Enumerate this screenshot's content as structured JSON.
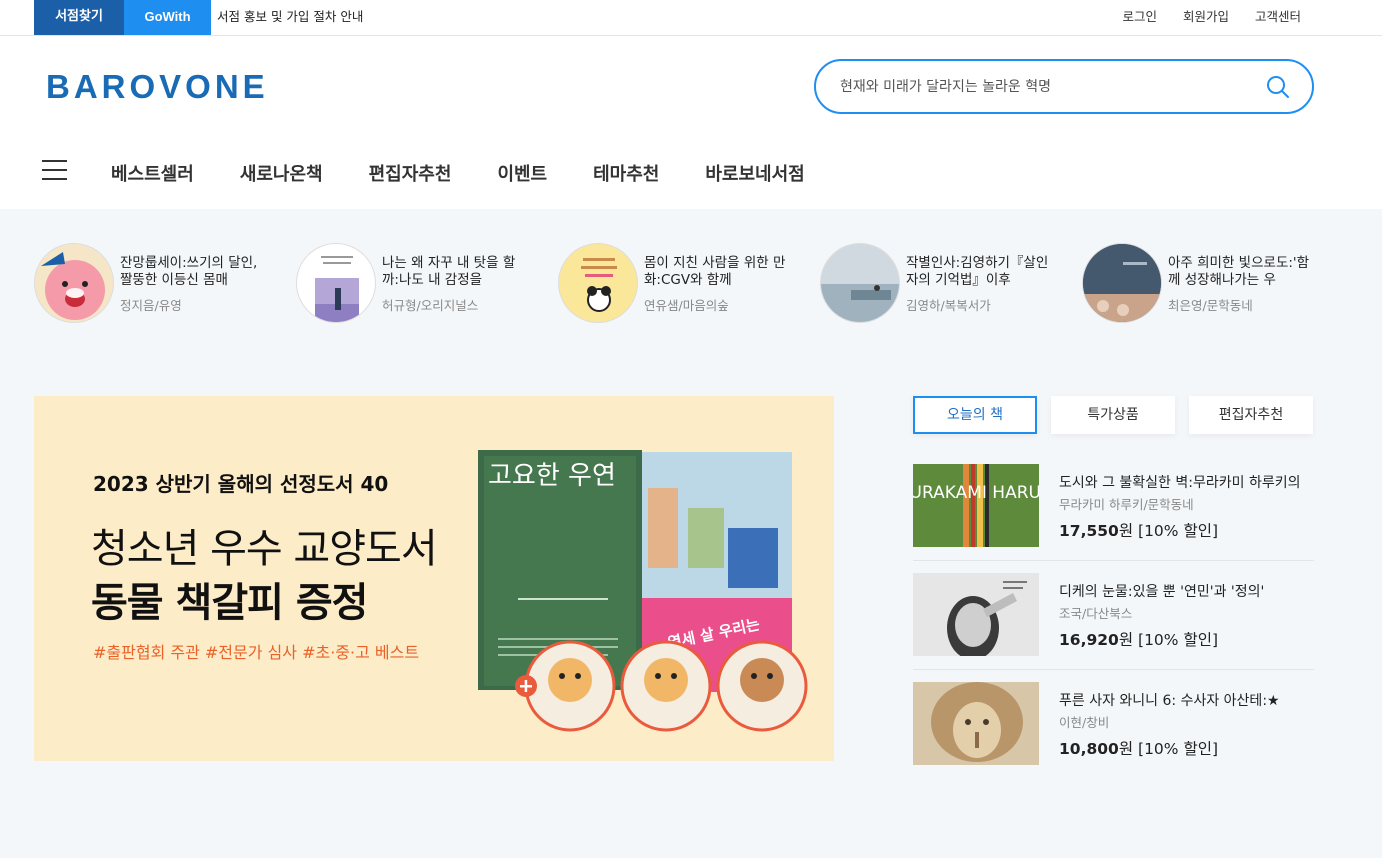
{
  "topbar": {
    "store_find": "서점찾기",
    "gowith": "GoWith",
    "notice": "서점 홍보 및 가입 절차 안내",
    "links": [
      "로그인",
      "회원가입",
      "고객센터"
    ]
  },
  "header": {
    "logo_text": "BAROVONE",
    "search_placeholder": "현재와 미래가 달라지는 놀라운 혁명"
  },
  "nav": [
    "베스트셀러",
    "새로나온책",
    "편집자추천",
    "이벤트",
    "테마추천",
    "바로보네서점"
  ],
  "stories": [
    {
      "title": "잔망룹세이:쓰기의 달인, 짤뚱한 이등신 몸매",
      "author": "정지음/유영"
    },
    {
      "title": "나는 왜 자꾸 내 탓을 할까:나도 내 감정을",
      "author": "허규형/오리지널스"
    },
    {
      "title": "몸이 지친 사람을 위한 만화:CGV와 함께",
      "author": "연유샘/마음의숲"
    },
    {
      "title": "작별인사:김영하기『살인자의 기억법』이후",
      "author": "김영하/복복서가"
    },
    {
      "title": "아주 희미한 빛으로도:'함께 성장해나가는 우",
      "author": "최은영/문학동네"
    }
  ],
  "banner": {
    "subtitle": "2023 상반기 올해의 선정도서 40",
    "line1": "청소년 우수 교양도서",
    "line2": "동물 책갈피 증정",
    "tags": "#출판협회 주관 #전문가 심사 #초·중·고 베스트",
    "book1_title": "고요한 우연",
    "book2_badge": "열세 살 우리는"
  },
  "tabs": [
    "오늘의 책",
    "특가상품",
    "편집자추천"
  ],
  "books": [
    {
      "title": "도시와 그 불확실한 벽:무라카미 하루키의",
      "author": "무라카미 하루키/문학동네",
      "price": "17,550",
      "unit": "원",
      "discount": " [10% 할인]",
      "cover_text": "MURAKAMI HARUKI"
    },
    {
      "title": "디케의 눈물:있을 뿐 '연민'과 '정의'",
      "author": "조국/다산북스",
      "price": "16,920",
      "unit": "원",
      "discount": " [10% 할인]"
    },
    {
      "title": "푸른 사자 와니니 6: 수사자 아산테:★",
      "author": "이현/창비",
      "price": "10,800",
      "unit": "원",
      "discount": " [10% 할인]"
    }
  ]
}
